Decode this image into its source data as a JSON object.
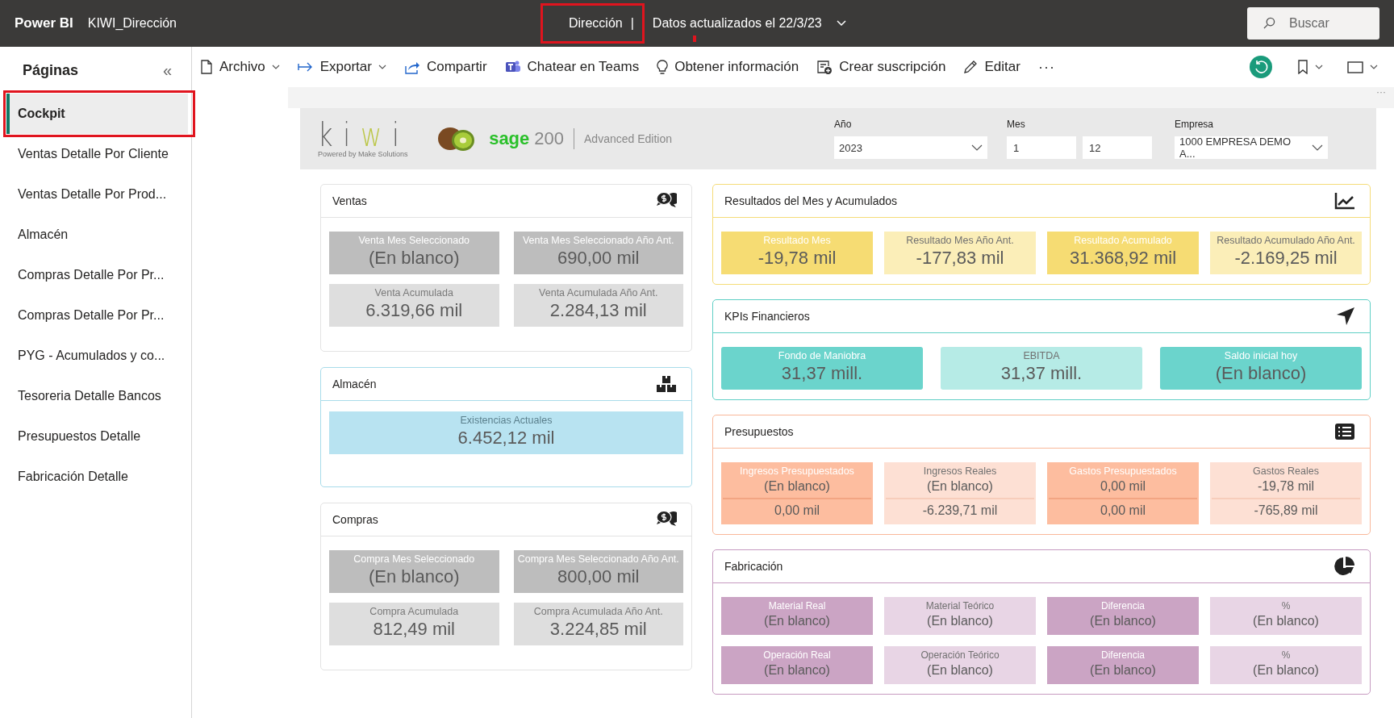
{
  "topbar": {
    "app": "Power BI",
    "report": "KIWI_Dirección",
    "page": "Dirección",
    "separator": "|",
    "updated": "Datos actualizados el 22/3/23",
    "search": {
      "placeholder": "Buscar"
    }
  },
  "sidebar": {
    "title": "Páginas",
    "collapse": "«",
    "items": [
      {
        "label": "Cockpit",
        "selected": true
      },
      {
        "label": "Ventas Detalle Por Cliente",
        "selected": false
      },
      {
        "label": "Ventas Detalle Por Prod...",
        "selected": false
      },
      {
        "label": "Almacén",
        "selected": false
      },
      {
        "label": "Compras Detalle Por Pr...",
        "selected": false
      },
      {
        "label": "Compras Detalle Por Pr...",
        "selected": false
      },
      {
        "label": "PYG - Acumulados y co...",
        "selected": false
      },
      {
        "label": "Tesoreria Detalle Bancos",
        "selected": false
      },
      {
        "label": "Presupuestos Detalle",
        "selected": false
      },
      {
        "label": "Fabricación Detalle",
        "selected": false
      }
    ]
  },
  "toolbar": {
    "items": [
      {
        "kind": "file",
        "label": "Archivo",
        "dropdown": true
      },
      {
        "kind": "export",
        "label": "Exportar",
        "dropdown": true
      },
      {
        "kind": "share",
        "label": "Compartir",
        "dropdown": false
      },
      {
        "kind": "teams",
        "label": "Chatear en Teams",
        "dropdown": false
      },
      {
        "kind": "bulb",
        "label": "Obtener información",
        "dropdown": false
      },
      {
        "kind": "subscribe",
        "label": "Crear suscripción",
        "dropdown": false
      },
      {
        "kind": "edit",
        "label": "Editar",
        "dropdown": false
      }
    ],
    "more": "···"
  },
  "canvas_more": "···",
  "header": {
    "logo": "kiwi",
    "logo_tagline": "Powered by Make Solutions",
    "brand": "sage",
    "brand_number": "200",
    "edition": "Advanced Edition",
    "filters": [
      {
        "kind": "select",
        "label": "Año",
        "values": [
          "2023"
        ]
      },
      {
        "kind": "range",
        "label": "Mes",
        "values": [
          "1",
          "12"
        ]
      },
      {
        "kind": "select",
        "label": "Empresa",
        "values": [
          "1000 EMPRESA DEMO A..."
        ]
      }
    ]
  },
  "columns": [
    [
      {
        "title": "Ventas",
        "kind": "gray",
        "rows": [
          [
            {
              "title": "Venta Mes Seleccionado",
              "highlighted": true,
              "values": [
                "(En blanco)"
              ]
            },
            {
              "title": "Venta Mes Seleccionado Año Ant.",
              "highlighted": true,
              "values": [
                "690,00 mil"
              ]
            }
          ],
          [
            {
              "title": "Venta Acumulada",
              "highlighted": false,
              "values": [
                "6.319,66 mil"
              ]
            },
            {
              "title": "Venta Acumulada Año Ant.",
              "highlighted": false,
              "values": [
                "2.284,13 mil"
              ]
            }
          ]
        ]
      },
      {
        "title": "Almacén",
        "kind": "blue",
        "rows": [
          [
            {
              "title": "Existencias Actuales",
              "highlighted": false,
              "values": [
                "6.452,12 mil"
              ]
            }
          ]
        ]
      },
      {
        "title": "Compras",
        "kind": "gray",
        "rows": [
          [
            {
              "title": "Compra Mes Seleccionado",
              "highlighted": true,
              "values": [
                "(En blanco)"
              ]
            },
            {
              "title": "Compra Mes Seleccionado Año Ant.",
              "highlighted": true,
              "values": [
                "800,00 mil"
              ]
            }
          ],
          [
            {
              "title": "Compra Acumulada",
              "highlighted": false,
              "values": [
                "812,49 mil"
              ]
            },
            {
              "title": "Compra Acumulada Año Ant.",
              "highlighted": false,
              "values": [
                "3.224,85 mil"
              ]
            }
          ]
        ]
      }
    ],
    [
      {
        "title": "Resultados del Mes y Acumulados",
        "kind": "yellow",
        "rows": [
          [
            {
              "title": "Resultado Mes",
              "highlighted": true,
              "values": [
                "-19,78 mil"
              ]
            },
            {
              "title": "Resultado Mes Año Ant.",
              "highlighted": false,
              "values": [
                "-177,83 mil"
              ]
            },
            {
              "title": "Resultado Acumulado",
              "highlighted": true,
              "values": [
                "31.368,92 mil"
              ]
            },
            {
              "title": "Resultado Acumulado Año Ant.",
              "highlighted": false,
              "values": [
                "-2.169,25 mil"
              ]
            }
          ]
        ]
      },
      {
        "title": "KPIs Financieros",
        "kind": "teal",
        "rows": [
          [
            {
              "title": "Fondo de Maniobra",
              "highlighted": true,
              "values": [
                "31,37 mill."
              ]
            },
            {
              "title": "EBITDA",
              "highlighted": false,
              "values": [
                "31,37 mill."
              ]
            },
            {
              "title": "Saldo inicial hoy",
              "highlighted": true,
              "values": [
                "(En blanco)"
              ]
            }
          ]
        ]
      },
      {
        "title": "Presupuestos",
        "kind": "salmon",
        "rows": [
          [
            {
              "title": "Ingresos Presupuestados",
              "highlighted": true,
              "values": [
                "(En blanco)",
                "0,00 mil"
              ]
            },
            {
              "title": "Ingresos Reales",
              "highlighted": false,
              "values": [
                "(En blanco)",
                "-6.239,71 mil"
              ]
            },
            {
              "title": "Gastos Presupuestados",
              "highlighted": true,
              "values": [
                "0,00 mil",
                "0,00 mil"
              ]
            },
            {
              "title": "Gastos Reales",
              "highlighted": false,
              "values": [
                "-19,78 mil",
                "-765,89 mil"
              ]
            }
          ]
        ]
      },
      {
        "title": "Fabricación",
        "kind": "purple",
        "rows": [
          [
            {
              "title": "Material Real",
              "highlighted": true,
              "values": [
                "(En blanco)"
              ]
            },
            {
              "title": "Material Teórico",
              "highlighted": false,
              "values": [
                "(En blanco)"
              ]
            },
            {
              "title": "Diferencia",
              "highlighted": true,
              "values": [
                "(En blanco)"
              ]
            },
            {
              "title": "%",
              "highlighted": false,
              "values": [
                "(En blanco)"
              ]
            }
          ],
          [
            {
              "title": "Operación Real",
              "highlighted": true,
              "values": [
                "(En blanco)"
              ]
            },
            {
              "title": "Operación Teórico",
              "highlighted": false,
              "values": [
                "(En blanco)"
              ]
            },
            {
              "title": "Diferencia",
              "highlighted": true,
              "values": [
                "(En blanco)"
              ]
            },
            {
              "title": "%",
              "highlighted": false,
              "values": [
                "(En blanco)"
              ]
            }
          ]
        ]
      }
    ]
  ]
}
